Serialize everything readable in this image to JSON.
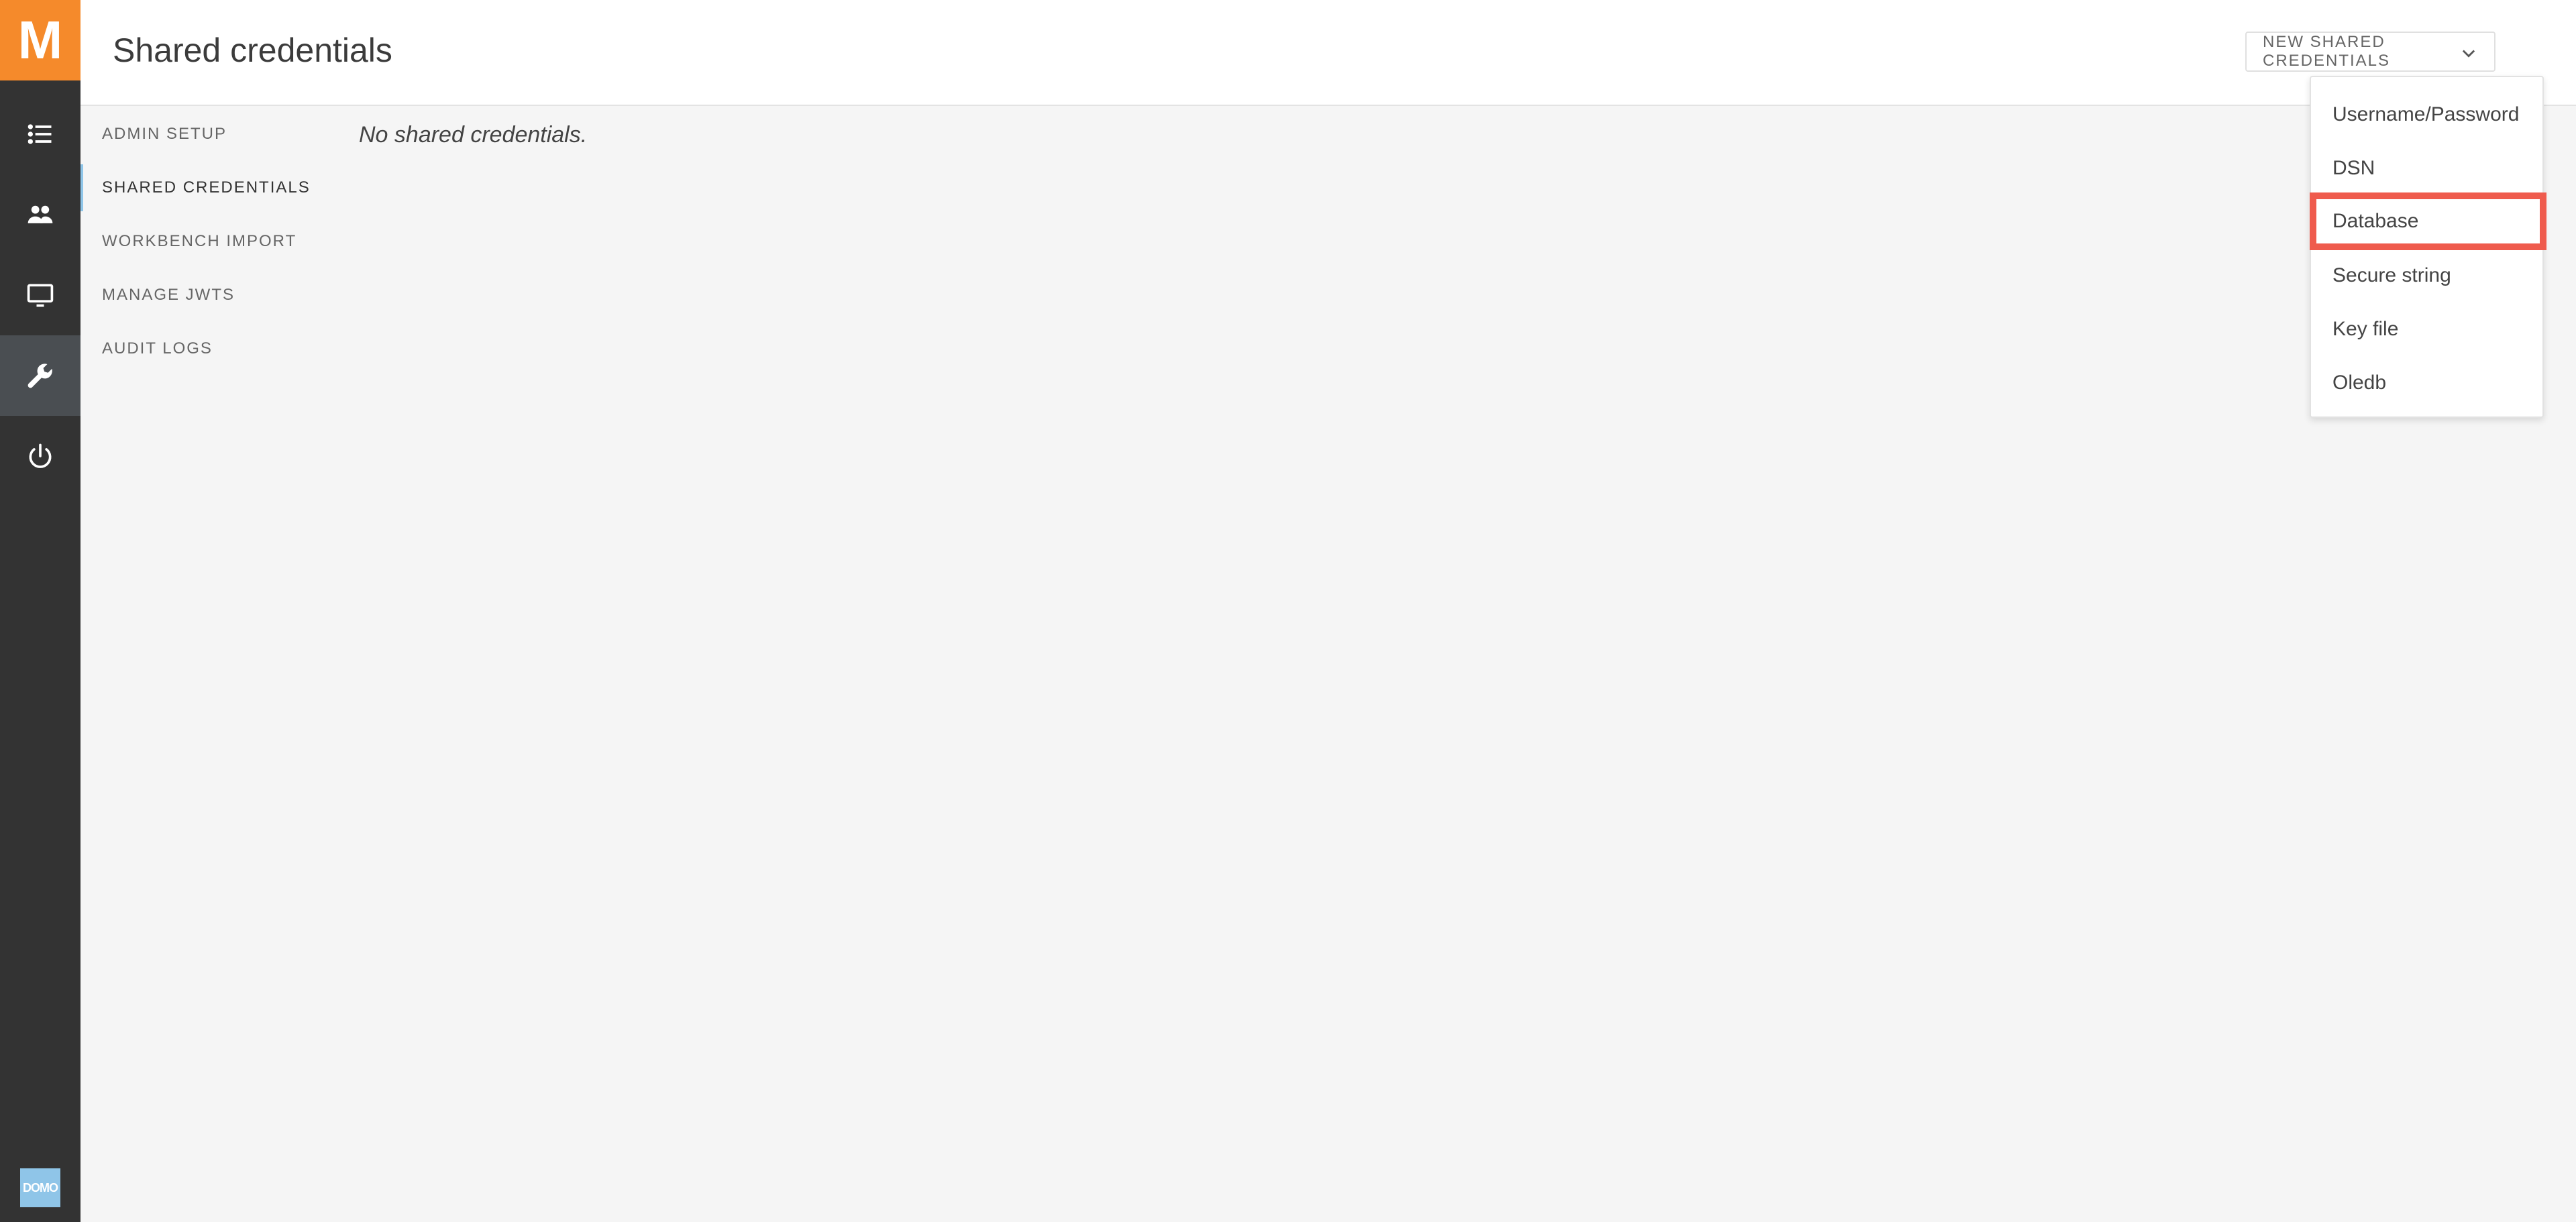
{
  "rail": {
    "logo_letter": "M",
    "bottom_logo_text": "DOMO",
    "items": [
      {
        "icon": "list-icon"
      },
      {
        "icon": "users-icon"
      },
      {
        "icon": "monitor-icon"
      },
      {
        "icon": "wrench-icon",
        "active": true
      },
      {
        "icon": "power-icon"
      }
    ]
  },
  "header": {
    "title": "Shared credentials",
    "new_button_label": "NEW SHARED CREDENTIALS"
  },
  "subnav": {
    "items": [
      {
        "label": "ADMIN SETUP"
      },
      {
        "label": "SHARED CREDENTIALS",
        "active": true
      },
      {
        "label": "WORKBENCH IMPORT"
      },
      {
        "label": "MANAGE JWTS"
      },
      {
        "label": "AUDIT LOGS"
      }
    ]
  },
  "main": {
    "empty_message": "No shared credentials."
  },
  "dropdown": {
    "items": [
      {
        "label": "Username/Password"
      },
      {
        "label": "DSN"
      },
      {
        "label": "Database",
        "highlighted": true
      },
      {
        "label": "Secure string"
      },
      {
        "label": "Key file"
      },
      {
        "label": "Oledb"
      }
    ]
  },
  "colors": {
    "rail_bg": "#333333",
    "brand_orange": "#f58a2b",
    "rail_active": "#4a4e52",
    "highlight_border": "#ef5b4d",
    "active_nav_accent": "#8fc5e8"
  }
}
